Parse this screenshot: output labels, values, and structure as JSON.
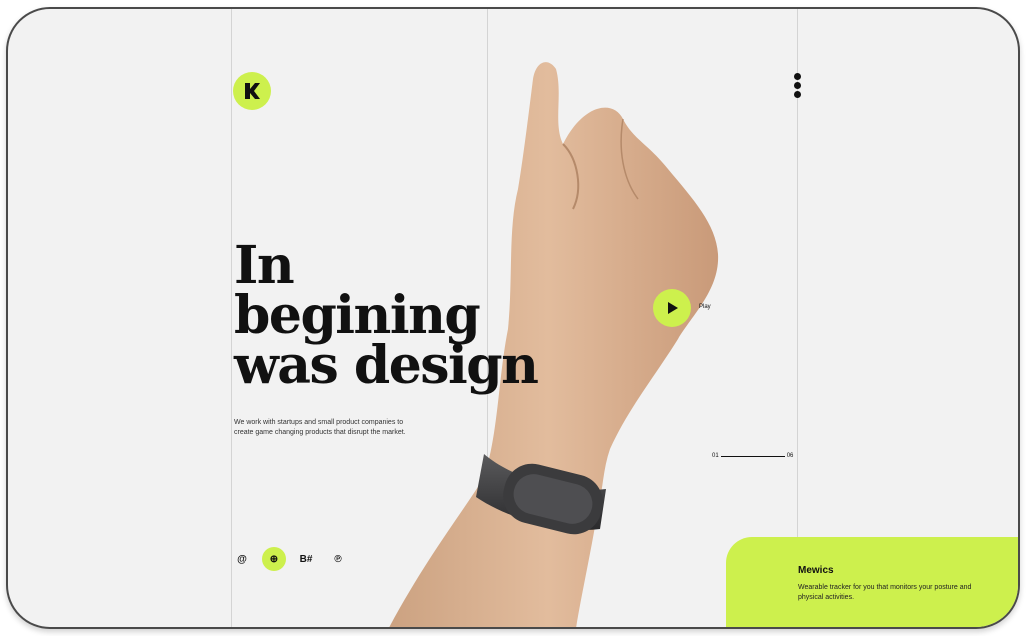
{
  "colors": {
    "accent": "#cdf04d",
    "background": "#f2f2f2",
    "frame": "#4a4a4a",
    "text": "#111111"
  },
  "header": {
    "logo_icon": "brand-k-icon",
    "menu_icon": "vertical-dots-icon"
  },
  "hero": {
    "title": "In\nbegining\nwas design",
    "text": "We work with startups and small product companies to create game changing products that disrupt the market."
  },
  "social": [
    {
      "icon": "at-icon",
      "label": "@"
    },
    {
      "icon": "dribbble-icon",
      "label": "⊕"
    },
    {
      "icon": "behance-icon",
      "label": "B#"
    },
    {
      "icon": "pinterest-icon",
      "label": "℗"
    }
  ],
  "video": {
    "label": "Play"
  },
  "slider": {
    "current": "01",
    "total": "06"
  },
  "product": {
    "name": "Mewics",
    "description": "Wearable tracker for you that monitors your posture and physical activities."
  }
}
